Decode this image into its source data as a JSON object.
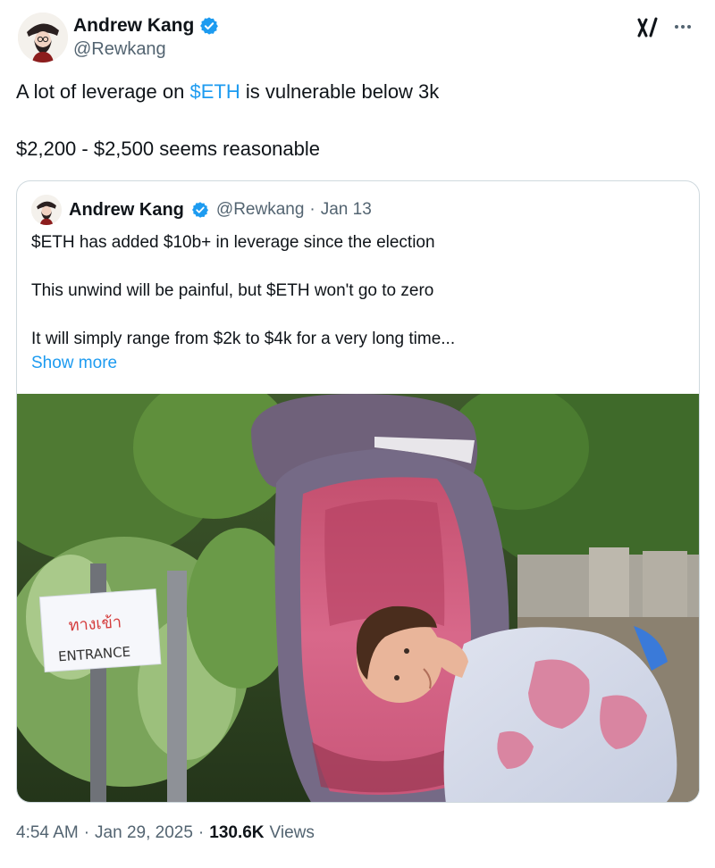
{
  "author": {
    "display_name": "Andrew Kang",
    "handle": "@Rewkang",
    "verified": true,
    "avatar_icon": "avatar-cartoon-icon"
  },
  "header_icons": {
    "app_logo": "x-grok-logo-icon",
    "more": "more-dots-icon"
  },
  "tweet": {
    "line1_prefix": "A lot of leverage on ",
    "line1_cashtag": "$ETH",
    "line1_suffix": " is vulnerable below 3k",
    "line2": "$2,200 - $2,500 seems reasonable"
  },
  "quoted_tweet": {
    "display_name": "Andrew Kang",
    "handle": "@Rewkang",
    "separator": "·",
    "date": "Jan 13",
    "lines": [
      "$ETH has added $10b+ in leverage since the election",
      "This unwind will be painful, but $ETH won't go to zero",
      "It will simply range from $2k to $4k for a very long time..."
    ],
    "show_more": "Show more",
    "photo": {
      "sign_thai": "ทางเข้า",
      "sign_english": "ENTRANCE"
    }
  },
  "footer": {
    "time": "4:54 AM",
    "sep1": "·",
    "date": "Jan 29, 2025",
    "sep2": "·",
    "views_count": "130.6K",
    "views_label": "Views"
  },
  "colors": {
    "link": "#1d9bf0",
    "secondary_text": "#536471",
    "border": "#cfd9de",
    "verified_badge": "#1d9bf0"
  }
}
